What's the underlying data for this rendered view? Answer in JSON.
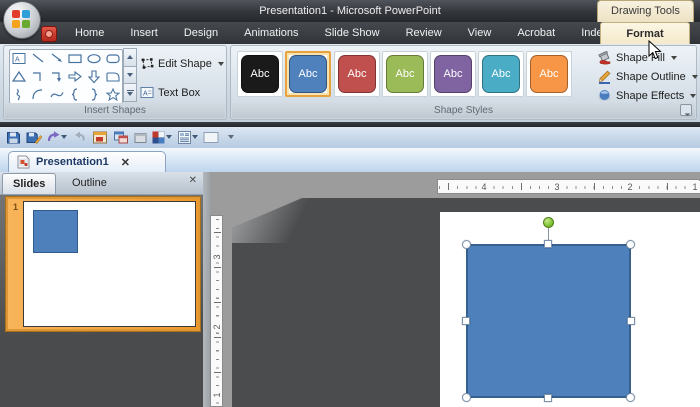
{
  "window": {
    "title": "Presentation1 - Microsoft PowerPoint",
    "contextual_group": "Drawing Tools"
  },
  "ribbon": {
    "tabs": [
      {
        "label": "Home"
      },
      {
        "label": "Insert"
      },
      {
        "label": "Design"
      },
      {
        "label": "Animations"
      },
      {
        "label": "Slide Show"
      },
      {
        "label": "Review"
      },
      {
        "label": "View"
      },
      {
        "label": "Acrobat"
      },
      {
        "label": "Indezine"
      },
      {
        "label": "Format",
        "active": true
      }
    ],
    "insert_shapes": {
      "group_label": "Insert Shapes",
      "shape_icons": [
        "text-box",
        "line",
        "arrow",
        "rectangle",
        "oval",
        "rounded-rectangle",
        "isosceles-triangle",
        "elbow-connector",
        "elbow-arrow-connector",
        "right-arrow",
        "down-arrow",
        "rounded-corner-rectangle",
        "scribble",
        "arc",
        "curve",
        "left-brace",
        "right-brace",
        "star"
      ],
      "buttons": {
        "edit_shape": "Edit Shape",
        "text_box": "Text Box"
      }
    },
    "shape_styles": {
      "group_label": "Shape Styles",
      "swatches": [
        {
          "label": "Abc",
          "color": "#1A1A1A",
          "selected": false
        },
        {
          "label": "Abc",
          "color": "#4F81BD",
          "selected": true
        },
        {
          "label": "Abc",
          "color": "#C0504D",
          "selected": false
        },
        {
          "label": "Abc",
          "color": "#9BBB59",
          "selected": false
        },
        {
          "label": "Abc",
          "color": "#8064A2",
          "selected": false
        },
        {
          "label": "Abc",
          "color": "#4BACC6",
          "selected": false
        },
        {
          "label": "Abc",
          "color": "#F79646",
          "selected": false
        }
      ],
      "buttons": {
        "fill": "Shape Fill",
        "outline": "Shape Outline",
        "effects": "Shape Effects"
      }
    }
  },
  "quick_toolbar": {
    "icons": [
      "save",
      "save-as",
      "undo",
      "redo",
      "print-preview",
      "switch-windows",
      "window",
      "grid-view",
      "outline-view",
      "slide-pane",
      "toolbar-options"
    ]
  },
  "document_tab": {
    "label": "Presentation1",
    "close": "✕"
  },
  "left_panel": {
    "tabs": [
      {
        "label": "Slides",
        "active": true
      },
      {
        "label": "Outline",
        "active": false
      }
    ],
    "close": "✕",
    "slide_number": "1"
  },
  "rulers": {
    "horizontal": [
      "4",
      "3",
      "2",
      "1"
    ],
    "vertical": [
      "3",
      "2",
      "1"
    ]
  },
  "canvas": {
    "shape_fill": "#4E80BC",
    "shape_border": "#36618E",
    "selection_handle": "#FFFFFF",
    "rotation_handle": "#7EC234"
  }
}
